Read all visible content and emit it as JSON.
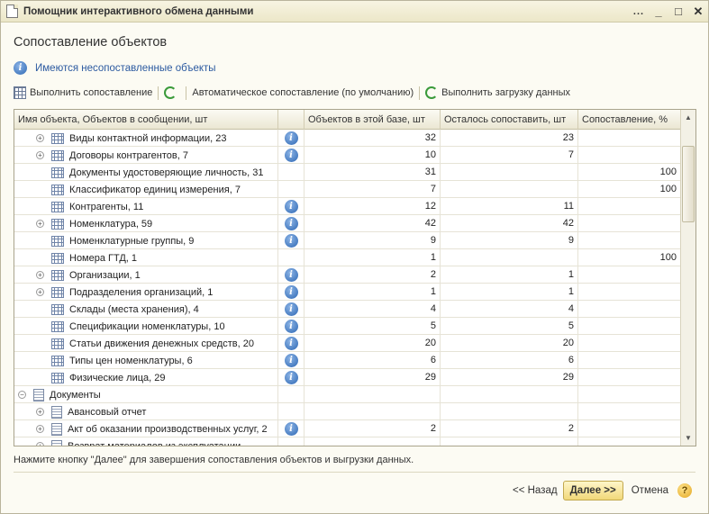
{
  "window": {
    "title": "Помощник интерактивного обмена данными",
    "controls": {
      "menu": "...",
      "minimize": "_",
      "maximize": "□",
      "close": "✕"
    }
  },
  "header": {
    "title": "Сопоставление объектов"
  },
  "info": {
    "text": "Имеются несопоставленные объекты"
  },
  "toolbar": {
    "run_match": "Выполнить сопоставление",
    "auto_match": "Автоматическое сопоставление (по умолчанию)",
    "run_load": "Выполнить загрузку данных"
  },
  "table": {
    "columns": [
      "Имя объекта, Объектов в сообщении, шт",
      "",
      "Объектов в этой базе, шт",
      "Осталось сопоставить, шт",
      "Сопоставление, %"
    ],
    "rows": [
      {
        "name": "Виды контактной информации, 23",
        "expander": "+",
        "icon": "table",
        "info": true,
        "in_base": "32",
        "remaining": "23",
        "percent": ""
      },
      {
        "name": "Договоры контрагентов, 7",
        "expander": "+",
        "icon": "table",
        "info": true,
        "in_base": "10",
        "remaining": "7",
        "percent": ""
      },
      {
        "name": "Документы удостоверяющие личность, 31",
        "expander": "",
        "icon": "table",
        "info": false,
        "in_base": "31",
        "remaining": "",
        "percent": "100"
      },
      {
        "name": "Классификатор единиц измерения, 7",
        "expander": "",
        "icon": "table",
        "info": false,
        "in_base": "7",
        "remaining": "",
        "percent": "100"
      },
      {
        "name": "Контрагенты, 11",
        "expander": "",
        "icon": "table",
        "info": true,
        "in_base": "12",
        "remaining": "11",
        "percent": ""
      },
      {
        "name": "Номенклатура, 59",
        "expander": "+",
        "icon": "table",
        "info": true,
        "in_base": "42",
        "remaining": "42",
        "percent": ""
      },
      {
        "name": "Номенклатурные группы, 9",
        "expander": "",
        "icon": "table",
        "info": true,
        "in_base": "9",
        "remaining": "9",
        "percent": ""
      },
      {
        "name": "Номера ГТД, 1",
        "expander": "",
        "icon": "table",
        "info": false,
        "in_base": "1",
        "remaining": "",
        "percent": "100"
      },
      {
        "name": "Организации, 1",
        "expander": "+",
        "icon": "table",
        "info": true,
        "in_base": "2",
        "remaining": "1",
        "percent": ""
      },
      {
        "name": "Подразделения организаций, 1",
        "expander": "+",
        "icon": "table",
        "info": true,
        "in_base": "1",
        "remaining": "1",
        "percent": ""
      },
      {
        "name": "Склады (места хранения), 4",
        "expander": "",
        "icon": "table",
        "info": true,
        "in_base": "4",
        "remaining": "4",
        "percent": ""
      },
      {
        "name": "Спецификации номенклатуры, 10",
        "expander": "",
        "icon": "table",
        "info": true,
        "in_base": "5",
        "remaining": "5",
        "percent": ""
      },
      {
        "name": "Статьи движения денежных средств, 20",
        "expander": "",
        "icon": "table",
        "info": true,
        "in_base": "20",
        "remaining": "20",
        "percent": ""
      },
      {
        "name": "Типы цен номенклатуры, 6",
        "expander": "",
        "icon": "table",
        "info": true,
        "in_base": "6",
        "remaining": "6",
        "percent": ""
      },
      {
        "name": "Физические лица, 29",
        "expander": "",
        "icon": "table",
        "info": true,
        "in_base": "29",
        "remaining": "29",
        "percent": ""
      },
      {
        "name": "Документы",
        "expander": "−",
        "icon": "doc",
        "info": false,
        "in_base": "",
        "remaining": "",
        "percent": "",
        "group": true
      },
      {
        "name": "Авансовый отчет",
        "expander": "+",
        "icon": "doc",
        "info": false,
        "in_base": "",
        "remaining": "",
        "percent": ""
      },
      {
        "name": "Акт об оказании производственных услуг, 2",
        "expander": "+",
        "icon": "doc",
        "info": true,
        "in_base": "2",
        "remaining": "2",
        "percent": ""
      },
      {
        "name": "Возврат материалов из эксплуатации",
        "expander": "+",
        "icon": "doc",
        "info": false,
        "in_base": "",
        "remaining": "",
        "percent": ""
      }
    ]
  },
  "hint": "Нажмите кнопку \"Далее\" для завершения сопоставления объектов и выгрузки данных.",
  "footer": {
    "back": "<< Назад",
    "next": "Далее >>",
    "cancel": "Отмена",
    "help": "?"
  }
}
